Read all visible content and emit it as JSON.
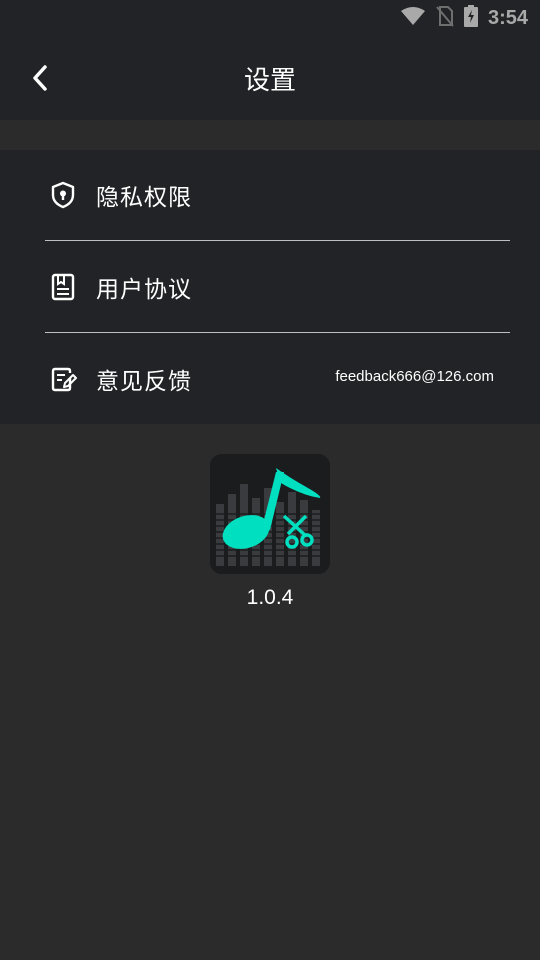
{
  "status_bar": {
    "time": "3:54",
    "icons": [
      "wifi-icon",
      "no-sim-icon",
      "battery-charging-icon"
    ]
  },
  "header": {
    "title": "设置",
    "back_icon": "chevron-left-icon"
  },
  "settings": {
    "items": [
      {
        "label": "隐私权限",
        "icon": "shield-lock-icon",
        "extra": ""
      },
      {
        "label": "用户协议",
        "icon": "document-icon",
        "extra": ""
      },
      {
        "label": "意见反馈",
        "icon": "feedback-edit-icon",
        "extra": "feedback666@126.com"
      }
    ]
  },
  "app": {
    "icon": "music-note-scissors-icon",
    "version": "1.0.4"
  },
  "colors": {
    "background": "#2b2b2b",
    "panel": "#222326",
    "accent": "#00e0c0",
    "text": "#ffffff"
  }
}
